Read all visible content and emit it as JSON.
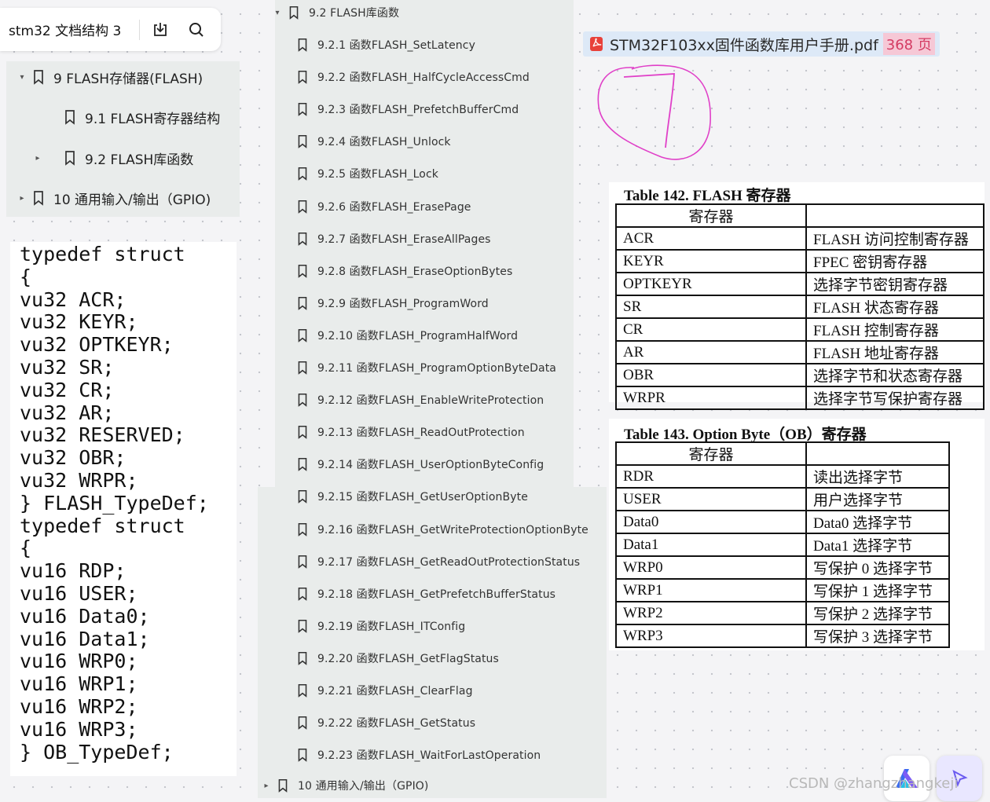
{
  "toolbar": {
    "title": "stm32 文档结构 3",
    "icons": [
      "download-icon",
      "search-icon"
    ]
  },
  "outline_left": {
    "items": [
      {
        "toggle": "▾",
        "label": "9 FLASH存储器(FLASH)"
      },
      {
        "toggle": "",
        "label": "9.1 FLASH寄存器结构"
      },
      {
        "toggle": "▸",
        "label": "9.2 FLASH库函数"
      },
      {
        "toggle": "▸",
        "label": "10 通用输入/输出（GPIO)"
      }
    ]
  },
  "outline_center": {
    "header": {
      "toggle": "▾",
      "label": "9.2 FLASH库函数"
    },
    "items": [
      "9.2.1 函数FLASH_SetLatency",
      "9.2.2 函数FLASH_HalfCycleAccessCmd",
      "9.2.3 函数FLASH_PrefetchBufferCmd",
      "9.2.4 函数FLASH_Unlock",
      "9.2.5 函数FLASH_Lock",
      "9.2.6 函数FLASH_ErasePage",
      "9.2.7 函数FLASH_EraseAllPages",
      "9.2.8 函数FLASH_EraseOptionBytes",
      "9.2.9 函数FLASH_ProgramWord",
      "9.2.10 函数FLASH_ProgramHalfWord",
      "9.2.11 函数FLASH_ProgramOptionByteData",
      "9.2.12 函数FLASH_EnableWriteProtection",
      "9.2.13 函数FLASH_ReadOutProtection",
      "9.2.14 函数FLASH_UserOptionByteConfig",
      "9.2.15 函数FLASH_GetUserOptionByte",
      "9.2.16 函数FLASH_GetWriteProtectionOptionByte",
      "9.2.17 函数FLASH_GetReadOutProtectionStatus",
      "9.2.18 函数FLASH_GetPrefetchBufferStatus",
      "9.2.19 函数FLASH_ITConfig",
      "9.2.20 函数FLASH_GetFlagStatus",
      "9.2.21 函数FLASH_ClearFlag",
      "9.2.22 函数FLASH_GetStatus",
      "9.2.23 函数FLASH_WaitForLastOperation"
    ],
    "footer": {
      "toggle": "▸",
      "label": "10 通用输入/输出（GPIO)"
    }
  },
  "code": {
    "lines": [
      "typedef struct",
      "{",
      "vu32 ACR;",
      "vu32 KEYR;",
      "vu32 OPTKEYR;",
      "vu32 SR;",
      "vu32 CR;",
      "vu32 AR;",
      "vu32 RESERVED;",
      "vu32 OBR;",
      "vu32 WRPR;",
      "} FLASH_TypeDef;",
      "typedef struct",
      "{",
      "vu16 RDP;",
      "vu16 USER;",
      "vu16 Data0;",
      "vu16 Data1;",
      "vu16 WRP0;",
      "vu16 WRP1;",
      "vu16 WRP2;",
      "vu16 WRP3;",
      "} OB_TypeDef;"
    ]
  },
  "pdf": {
    "filename": "STM32F103xx固件函数库用户手册.pdf",
    "pages": "368 页",
    "icon": "pdf-icon"
  },
  "annotation": {
    "drawing": "handwritten 7 in circle",
    "color": "#e040c8"
  },
  "table142": {
    "title": "Table 142. FLASH 寄存器",
    "header": [
      "寄存器",
      ""
    ],
    "rows": [
      [
        "ACR",
        "FLASH 访问控制寄存器"
      ],
      [
        "KEYR",
        "FPEC 密钥寄存器"
      ],
      [
        "OPTKEYR",
        "选择字节密钥寄存器"
      ],
      [
        "SR",
        "FLASH 状态寄存器"
      ],
      [
        "CR",
        "FLASH 控制寄存器"
      ],
      [
        "AR",
        "FLASH 地址寄存器"
      ],
      [
        "OBR",
        "选择字节和状态寄存器"
      ],
      [
        "WRPR",
        "选择字节写保护寄存器"
      ]
    ]
  },
  "table143": {
    "title": "Table 143. Option Byte（OB）寄存器",
    "header": [
      "寄存器",
      ""
    ],
    "rows": [
      [
        "RDR",
        "读出选择字节"
      ],
      [
        "USER",
        "用户选择字节"
      ],
      [
        "Data0",
        "Data0 选择字节"
      ],
      [
        "Data1",
        "Data1 选择字节"
      ],
      [
        "WRP0",
        "写保护 0 选择字节"
      ],
      [
        "WRP1",
        "写保护 1 选择字节"
      ],
      [
        "WRP2",
        "写保护 2 选择字节"
      ],
      [
        "WRP3",
        "写保护 3 选择字节"
      ]
    ]
  },
  "watermark": "CSDN @zhangzhangkeji",
  "colors": {
    "panel": "#e9eceb",
    "accent_pink": "#d43a62",
    "annotation": "#e040c8"
  }
}
